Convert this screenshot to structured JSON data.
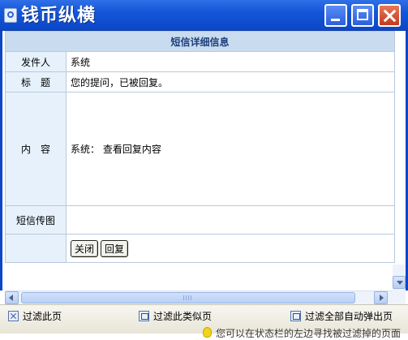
{
  "window": {
    "title": "钱币纵横"
  },
  "detail": {
    "header": "短信详细信息",
    "rows": {
      "sender": {
        "label": "发件人",
        "value": "系统"
      },
      "subject": {
        "label": "标　题",
        "value": "您的提问，已被回复。"
      },
      "content": {
        "label": "内　容",
        "value": "系统：  查看回复内容"
      },
      "image": {
        "label": "短信传图",
        "value": ""
      }
    },
    "buttons": {
      "close": "关闭",
      "reply": "回复"
    }
  },
  "filterbar": {
    "filter_page": "过滤此页",
    "filter_similar": "过滤此类似页",
    "filter_all_popups": "过滤全部自动弹出页",
    "hint": "您可以在状态栏的左边寻找被过滤掉的页面"
  },
  "icons": [
    "app-icon",
    "minimize-icon",
    "maximize-icon",
    "close-icon",
    "filter-icon",
    "bulb-icon"
  ],
  "colors": {
    "titlebar": "#1556d8",
    "header_bg": "#c9dcef",
    "label_bg": "#e6f1fb"
  }
}
